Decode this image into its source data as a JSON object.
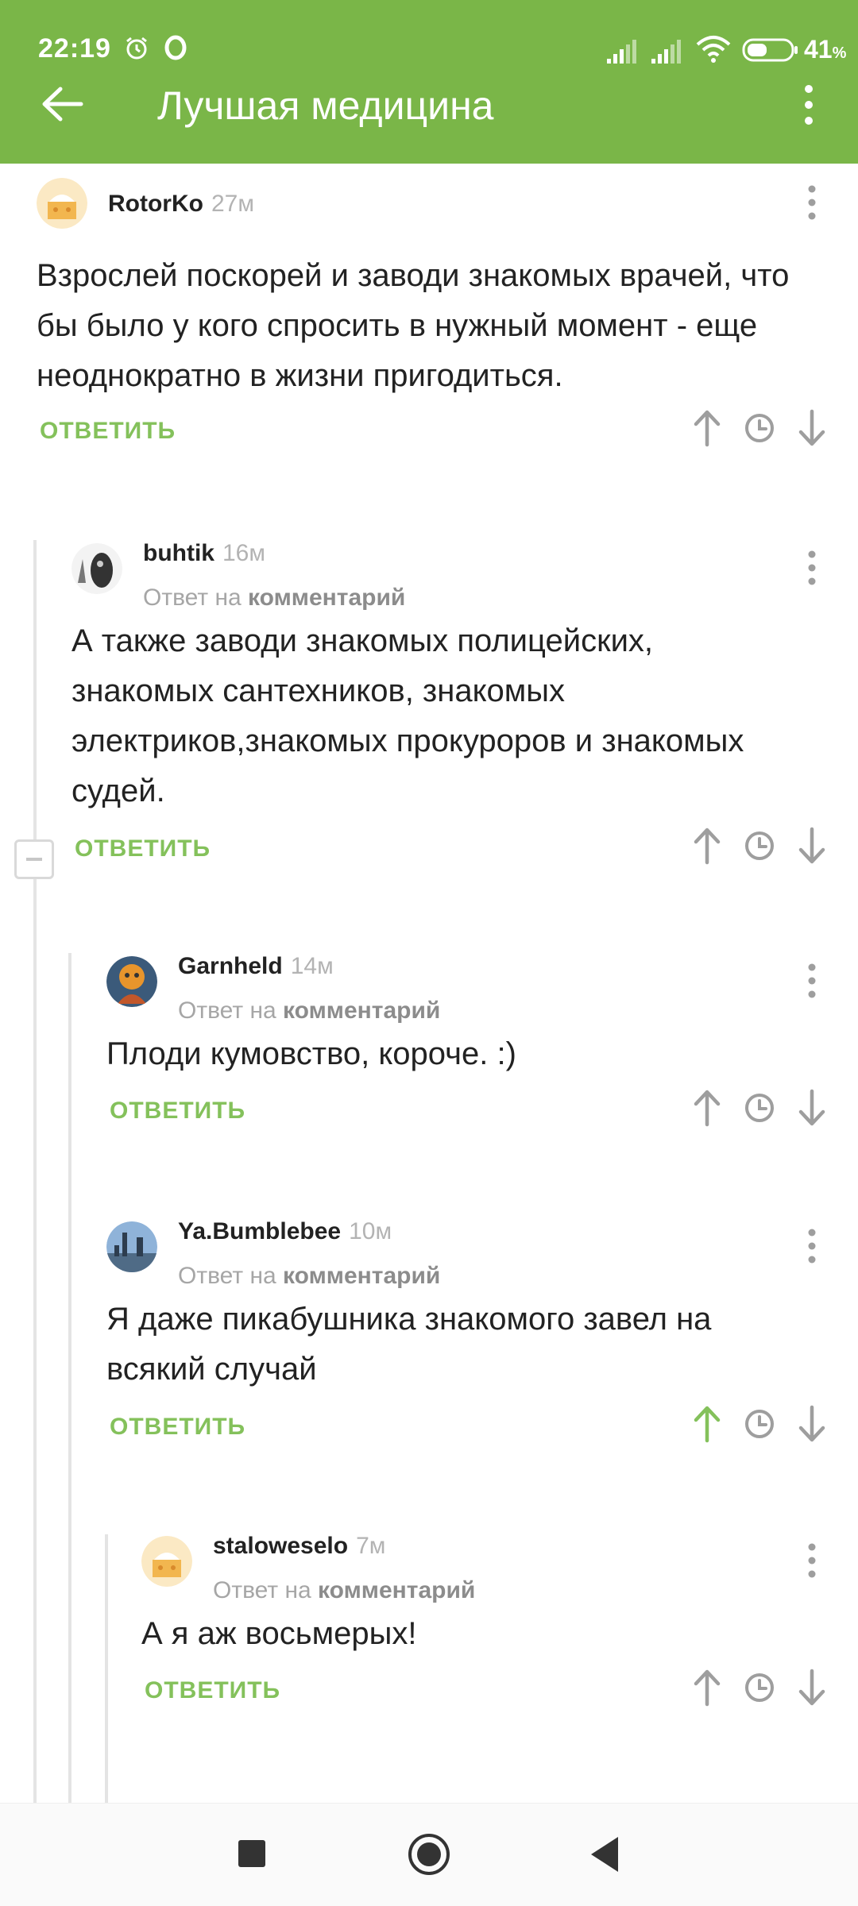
{
  "status_bar": {
    "time": "22:19",
    "battery": "41",
    "battery_unit": "%",
    "icons": [
      "alarm-icon",
      "opera-icon",
      "signal-icon",
      "signal-icon",
      "wifi-icon",
      "battery-icon"
    ]
  },
  "app_bar": {
    "title": "Лучшая медицина",
    "back_icon": "arrow-left-icon",
    "more_icon": "more-vertical-icon"
  },
  "reply_to_prefix": "Ответ на",
  "reply_to_target": "комментарий",
  "reply_label": "ОТВЕТИТЬ",
  "colors": {
    "accent": "#7ab648",
    "reply": "#84c15b",
    "upvoted": "#84c15b",
    "icon_gray": "#9e9e9e"
  },
  "comments": [
    {
      "user": "RotorKo",
      "time": "27м",
      "text": "Взрослей поскорей и заводи знакомых врачей, что бы было у кого спросить в нужный момент - еще неоднократно в жизни пригодиться.",
      "is_reply": false,
      "upvoted": false
    },
    {
      "user": "buhtik",
      "time": "16м",
      "text": "А также заводи знакомых полицейских, знакомых сантехников, знакомых электриков,знакомых прокуроров и знакомых судей.",
      "is_reply": true,
      "upvoted": false
    },
    {
      "user": "Garnheld",
      "time": "14м",
      "text": "Плоди кумовство, короче. :)",
      "is_reply": true,
      "upvoted": false
    },
    {
      "user": "Ya.Bumblebee",
      "time": "10м",
      "text": "Я даже пикабушника знакомого завел на всякий случай",
      "is_reply": true,
      "upvoted": true
    },
    {
      "user": "staloweselo",
      "time": "7м",
      "text": "А я аж восьмерых!",
      "is_reply": true,
      "upvoted": false
    }
  ]
}
